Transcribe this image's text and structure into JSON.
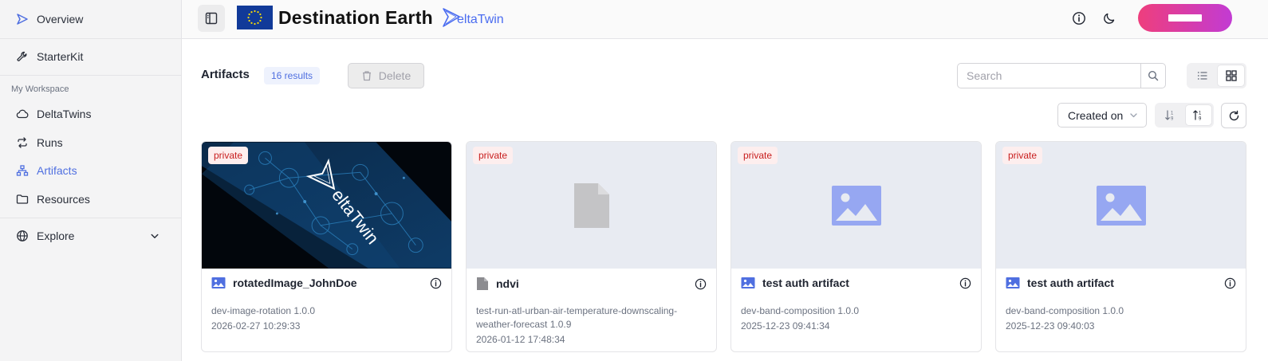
{
  "sidebar": {
    "overview": "Overview",
    "starterkit": "StarterKit",
    "workspace_label": "My Workspace",
    "deltatwins": "DeltaTwins",
    "runs": "Runs",
    "artifacts": "Artifacts",
    "resources": "Resources",
    "explore": "Explore"
  },
  "header": {
    "brand_title": "Destination Earth",
    "deltatwin_logo_text": "eltaTwin"
  },
  "toolbar": {
    "title": "Artifacts",
    "result_count": "16 results",
    "delete_label": "Delete",
    "search_placeholder": "Search",
    "sort_label": "Created on"
  },
  "cards": [
    {
      "badge": "private",
      "title": "rotatedImage_JohnDoe",
      "icon": "image-icon",
      "subtitle": "dev-image-rotation 1.0.0",
      "date": "2026-02-27 10:29:33",
      "thumbnail_text": "eltaTwin"
    },
    {
      "badge": "private",
      "title": "ndvi",
      "icon": "file-icon",
      "subtitle": "test-run-atl-urban-air-temperature-downscaling-weather-forecast 1.0.9",
      "date": "2026-01-12 17:48:34"
    },
    {
      "badge": "private",
      "title": "test auth artifact",
      "icon": "image-icon",
      "subtitle": "dev-band-composition 1.0.0",
      "date": "2025-12-23 09:41:34"
    },
    {
      "badge": "private",
      "title": "test auth artifact",
      "icon": "image-icon",
      "subtitle": "dev-band-composition 1.0.0",
      "date": "2025-12-23 09:40:03"
    }
  ],
  "colors": {
    "accent": "#4f6fe0",
    "private_badge": "#c81e1e",
    "user_button_gradient_start": "#ee3e7d",
    "user_button_gradient_end": "#c23bd3"
  }
}
